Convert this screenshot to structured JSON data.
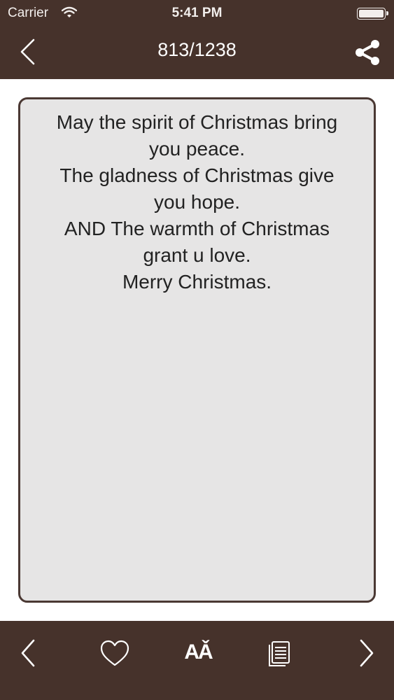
{
  "status_bar": {
    "carrier": "Carrier",
    "time": "5:41 PM"
  },
  "nav": {
    "title": "813/1238",
    "back_icon": "chevron-left-icon",
    "share_icon": "share-icon"
  },
  "message": {
    "lines": [
      "May the spirit of Christmas bring",
      "you peace.",
      "The gladness of Christmas give",
      "you hope.",
      "AND The warmth of Christmas",
      "grant u love.",
      "Merry Christmas."
    ]
  },
  "toolbar": {
    "font_label": "AǍ",
    "icons": [
      "chevron-left-icon",
      "heart-icon",
      "font-size-icon",
      "copy-icon",
      "chevron-right-icon"
    ]
  },
  "colors": {
    "bar_background": "#46322b",
    "card_background": "#e6e5e5",
    "card_border": "#4a3833",
    "text": "#222222"
  }
}
